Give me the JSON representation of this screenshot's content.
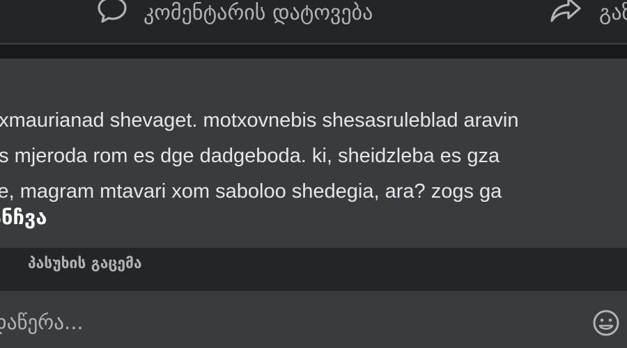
{
  "actions": {
    "comment_label": "კომენტარის დატოვება",
    "share_label": "გაზიარება"
  },
  "post": {
    "lines": [
      "uxmaurianad shevaget. motxovnebis shesasruleblad aravin",
      "ris mjeroda rom es dge dadgeboda. ki, sheidzleba es gza",
      "ke, magram mtavari xom saboloo shedegia, ara? zogs ga"
    ],
    "author": "ანჩვა"
  },
  "reply": {
    "label": "პასუხის გაცემა"
  },
  "comment_box": {
    "placeholder": "დაწერა..."
  },
  "icons": {
    "comment": "comment-bubble-icon",
    "share": "share-arrow-icon",
    "emoji": "emoji-icon"
  },
  "colors": {
    "background": "#18191a",
    "surface": "#242526",
    "card": "#3a3b3c",
    "text_primary": "#e4e6eb",
    "text_secondary": "#b0b3b8"
  }
}
